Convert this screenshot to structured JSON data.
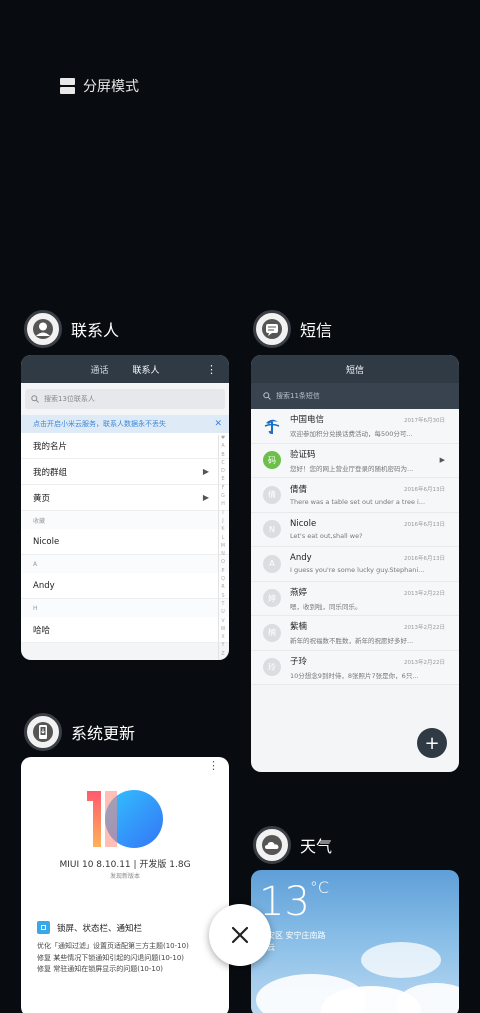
{
  "split_mode": {
    "label": "分屏模式"
  },
  "apps": {
    "contacts": {
      "title": "联系人",
      "tabs": [
        "通话",
        "联系人"
      ],
      "search_placeholder": "搜索13位联系人",
      "banner": "点击开启小米云服务，联系人数据永不丢失",
      "rows": [
        {
          "type": "item",
          "label": "我的名片",
          "arrow": false
        },
        {
          "type": "item",
          "label": "我的群组",
          "arrow": true
        },
        {
          "type": "item",
          "label": "黄页",
          "arrow": true
        },
        {
          "type": "section",
          "label": "收藏"
        },
        {
          "type": "item",
          "label": "Nicole",
          "arrow": false
        },
        {
          "type": "section",
          "label": "A"
        },
        {
          "type": "item",
          "label": "Andy",
          "arrow": false
        },
        {
          "type": "section",
          "label": "H"
        },
        {
          "type": "item",
          "label": "哈哈",
          "arrow": false
        }
      ],
      "alphabet": [
        "♥",
        "A",
        "B",
        "C",
        "D",
        "E",
        "F",
        "G",
        "H",
        "I",
        "J",
        "K",
        "L",
        "M",
        "N",
        "O",
        "P",
        "Q",
        "R",
        "S",
        "T",
        "U",
        "V",
        "W",
        "X",
        "Y",
        "Z",
        "#"
      ]
    },
    "sms": {
      "title": "短信",
      "header": "短信",
      "search_placeholder": "搜索11条短信",
      "rows": [
        {
          "name": "中国电信",
          "msg": "欢迎参加积分兑换话费活动，每500分可...",
          "date": "2017年6月30日",
          "avatar": "",
          "kind": "telecom"
        },
        {
          "name": "验证码",
          "msg": "您好！您的网上营业厅登录的随机密码为...",
          "date": "",
          "avatar": "码",
          "kind": "code"
        },
        {
          "name": "倩倩",
          "msg": "There was a table set out under a tree i...",
          "date": "2016年6月13日",
          "avatar": "倩",
          "kind": "plain"
        },
        {
          "name": "Nicole",
          "msg": "Let's eat out,shall we?",
          "date": "2016年6月13日",
          "avatar": "N",
          "kind": "plain"
        },
        {
          "name": "Andy",
          "msg": "I guess you're some lucky guy.Stephani...",
          "date": "2016年6月13日",
          "avatar": "A",
          "kind": "plain"
        },
        {
          "name": "燕婷",
          "msg": "嗯，收到啦，同乐同乐。",
          "date": "2013年2月22日",
          "avatar": "婷",
          "kind": "plain"
        },
        {
          "name": "紫楠",
          "msg": "新年的祝福数不胜数，新年的祝愿好多好...",
          "date": "2013年2月22日",
          "avatar": "楠",
          "kind": "plain"
        },
        {
          "name": "子玲",
          "msg": "10分想念9到时侍，8张照片7张是你，6只...",
          "date": "2013年2月22日",
          "avatar": "玲",
          "kind": "plain"
        }
      ],
      "fab": "+"
    },
    "updater": {
      "title": "系统更新",
      "version": "MIUI 10 8.10.11 | 开发版 1.8G",
      "subtitle": "发现新版本",
      "feature": "锁屏、状态栏、通知栏",
      "lines": [
        "优化「通知过滤」设置页适配第三方主题(10-10)",
        "修复 某些情况下锁通知引起的闪退问题(10-10)",
        "修复 常驻通知在锁屏显示的问题(10-10)"
      ]
    },
    "weather": {
      "title": "天气",
      "temp": "13",
      "unit": "°C",
      "location_line1": "宝安区 安宁庄南路",
      "location_line2": "多云"
    }
  },
  "colors": {
    "background": "#080b0f",
    "card_header": "#2f3a45",
    "accent_blue": "#3a86d6",
    "code_green": "#6cc04a"
  }
}
